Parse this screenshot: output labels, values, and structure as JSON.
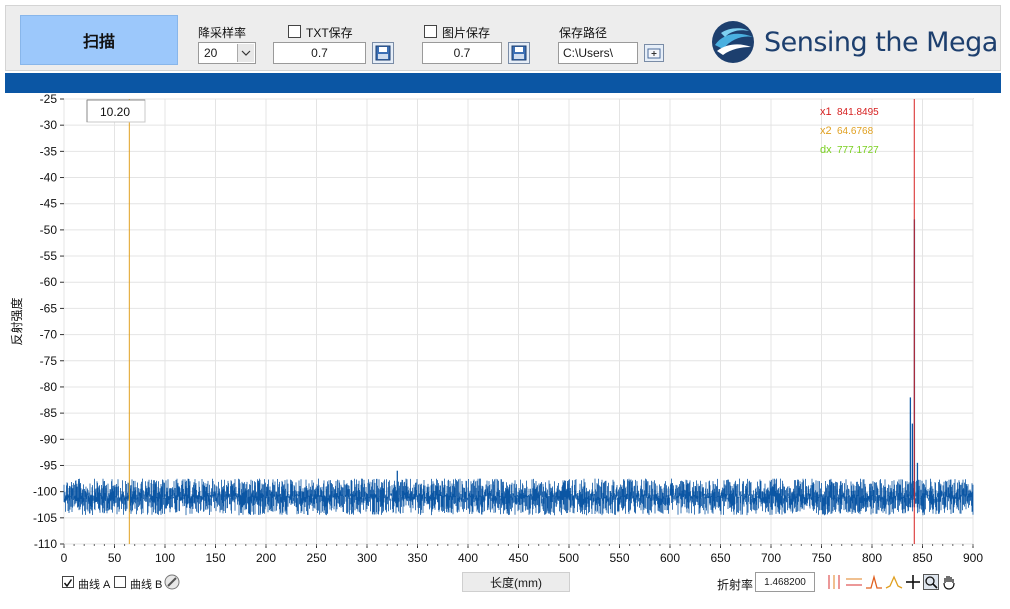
{
  "toolbar": {
    "scan_label": "扫描",
    "downsample_label": "降采样率",
    "downsample_value": "20",
    "txt_save_label": "TXT保存",
    "txt_save_checked": false,
    "txt_value": "0.7",
    "img_save_label": "图片保存",
    "img_save_checked": false,
    "img_value": "0.7",
    "path_label": "保存路径",
    "path_value": "C:\\Users\\"
  },
  "brand": {
    "text": "Sensing the Mega",
    "color": "#1d3f6e"
  },
  "colors": {
    "header_bar": "#0b56a4",
    "scan_button": "#9cc8fb",
    "signal": "#0b56a4",
    "cursor1": "#d62020",
    "cursor2": "#e0a020",
    "dx": "#7ad020"
  },
  "chart_data": {
    "type": "line",
    "xlabel": "长度(mm)",
    "ylabel": "反射强度",
    "xlim": [
      0,
      900
    ],
    "ylim": [
      -110,
      -25
    ],
    "x_ticks": [
      0,
      50,
      100,
      150,
      200,
      250,
      300,
      350,
      400,
      450,
      500,
      550,
      600,
      650,
      700,
      750,
      800,
      850,
      900
    ],
    "y_ticks": [
      -25,
      -30,
      -35,
      -40,
      -45,
      -50,
      -55,
      -60,
      -65,
      -70,
      -75,
      -80,
      -85,
      -90,
      -95,
      -100,
      -105,
      -110
    ],
    "grid": true,
    "series": [
      {
        "name": "曲线 A",
        "noise_floor": -101.5,
        "noise_band": [
          -104.5,
          -97.5
        ],
        "peaks": [
          {
            "x": 330,
            "y": -96.0
          },
          {
            "x": 838,
            "y": -82.0
          },
          {
            "x": 840,
            "y": -87.0
          },
          {
            "x": 842,
            "y": -48.0
          },
          {
            "x": 845,
            "y": -94.5
          }
        ]
      }
    ],
    "cursors": [
      {
        "label": "x1",
        "value": "841.8495",
        "x": 841.8495,
        "color": "#d62020"
      },
      {
        "label": "x2",
        "value": "64.6768",
        "x": 64.6768,
        "color": "#e0a020"
      },
      {
        "label": "dx",
        "value": "777.1727",
        "color": "#7ad020"
      }
    ],
    "display_value": "10.20"
  },
  "bottom": {
    "curve_a_label": "曲线 A",
    "curve_a_checked": true,
    "curve_b_label": "曲线 B",
    "curve_b_checked": false,
    "xaxis_label": "长度(mm)",
    "refr_label": "折射率",
    "refr_value": "1.468200"
  }
}
